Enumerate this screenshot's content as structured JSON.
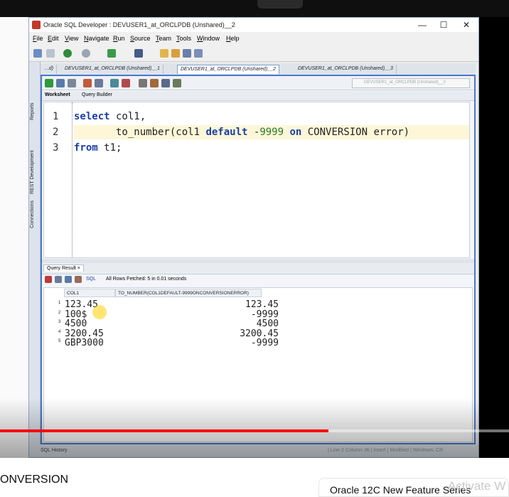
{
  "window": {
    "title": "Oracle SQL Developer : DEVUSER1_at_ORCLPDB (Unshared)__2",
    "controls": [
      "—",
      "☐",
      "✕"
    ]
  },
  "menu": [
    "File",
    "Edit",
    "View",
    "Navigate",
    "Run",
    "Source",
    "Team",
    "Tools",
    "Window",
    "Help"
  ],
  "doc_tabs": [
    {
      "label": "...d)"
    },
    {
      "label": "DEVUSER1_at_ORCLPDB (Unshared)__1"
    },
    {
      "label": "DEVUSER1_at_ORCLPDB (Unshared)__2"
    },
    {
      "label": "DEVUSER1_at_ORCLPDB (Unshared)__3"
    }
  ],
  "side_tabs": [
    "Reports",
    "REST Development",
    "Connections"
  ],
  "editor": {
    "connection": "DEVUSER1_at_ORCLPDB (Unshared)__2",
    "subtabs": [
      "Worksheet",
      "Query Builder"
    ],
    "lines": [
      {
        "n": "1",
        "parts": [
          {
            "t": "select",
            "c": "kw"
          },
          {
            "t": " col1,",
            "c": ""
          }
        ]
      },
      {
        "n": "2",
        "parts": [
          {
            "t": "       to_number(col1 ",
            "c": ""
          },
          {
            "t": "default",
            "c": "kw"
          },
          {
            "t": " -",
            "c": ""
          },
          {
            "t": "9999",
            "c": "num"
          },
          {
            "t": " ",
            "c": ""
          },
          {
            "t": "on",
            "c": "kw"
          },
          {
            "t": " CONVERSION error)",
            "c": ""
          }
        ]
      },
      {
        "n": "3",
        "parts": [
          {
            "t": "from",
            "c": "kw"
          },
          {
            "t": " t1;",
            "c": ""
          }
        ]
      }
    ]
  },
  "result": {
    "tab_label": "Query Result",
    "sql_label": "SQL",
    "status": "All Rows Fetched: 5 in 0.01 seconds",
    "columns": [
      "COL1",
      "TO_NUMBER(COL1DEFAULT-9999ONCONVERSIONERROR)"
    ],
    "rows": [
      {
        "n": "1",
        "col1": "123.45",
        "val": "123.45"
      },
      {
        "n": "2",
        "col1": "100$",
        "val": "-9999"
      },
      {
        "n": "3",
        "col1": "4500",
        "val": "4500"
      },
      {
        "n": "4",
        "col1": "3200.45",
        "val": "3200.45"
      },
      {
        "n": "5",
        "col1": "GBP3000",
        "val": "-9999"
      }
    ]
  },
  "statusbar": {
    "left": "SQL History",
    "right": "| Line 2 Column 36  | Insert  | Modified | Windows: CR"
  },
  "video": {
    "progress": 0.645,
    "left_title": "ONVERSION",
    "series": "Oracle 12C New Feature Series",
    "watermark": "Activate W"
  },
  "colors": {
    "accent": "#4a78c8",
    "keyword": "#1c3fa8",
    "number": "#2f7a2a",
    "progress": "#ff0000"
  }
}
